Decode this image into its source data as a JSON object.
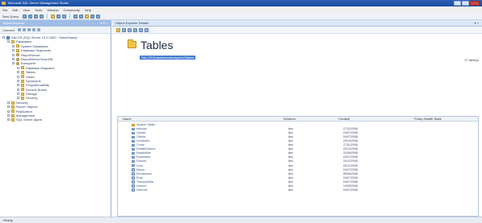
{
  "window": {
    "title": "Microsoft SQL Server Management Studio"
  },
  "menu": [
    "File",
    "Edit",
    "View",
    "Tools",
    "Window",
    "Community",
    "Help"
  ],
  "toolbar": {
    "new_query": "New Query"
  },
  "object_explorer": {
    "title": "Object Explorer",
    "connect_label": "Connect",
    "tree": [
      {
        "label": "SALOS (SQL Server 10.0.1600 - Salos\\Salos)",
        "level": 0,
        "icon": "server"
      },
      {
        "label": "Databases",
        "level": 1,
        "icon": "folder"
      },
      {
        "label": "System Databases",
        "level": 2,
        "icon": "folder"
      },
      {
        "label": "Database Snapshots",
        "level": 2,
        "icon": "folder"
      },
      {
        "label": "ReportServer",
        "level": 2,
        "icon": "database"
      },
      {
        "label": "ReportServerTempDB",
        "level": 2,
        "icon": "database"
      },
      {
        "label": "transporte",
        "level": 2,
        "icon": "database"
      },
      {
        "label": "Database Diagrams",
        "level": 3,
        "icon": "folder"
      },
      {
        "label": "Tables",
        "level": 3,
        "icon": "folder"
      },
      {
        "label": "Views",
        "level": 3,
        "icon": "folder"
      },
      {
        "label": "Synonyms",
        "level": 3,
        "icon": "folder"
      },
      {
        "label": "Programmability",
        "level": 3,
        "icon": "folder"
      },
      {
        "label": "Service Broker",
        "level": 3,
        "icon": "folder"
      },
      {
        "label": "Storage",
        "level": 3,
        "icon": "folder"
      },
      {
        "label": "Security",
        "level": 3,
        "icon": "folder"
      },
      {
        "label": "Security",
        "level": 1,
        "icon": "folder"
      },
      {
        "label": "Server Objects",
        "level": 1,
        "icon": "folder"
      },
      {
        "label": "Replication",
        "level": 1,
        "icon": "folder"
      },
      {
        "label": "Management",
        "level": 1,
        "icon": "folder"
      },
      {
        "label": "SQL Server Agent",
        "level": 1,
        "icon": "folder"
      }
    ]
  },
  "details": {
    "tab_title": "Object Explorer Details",
    "heading": "Tables",
    "path": "SALOS\\Databases\\transporte\\Tables",
    "item_count": "17 Item(s)",
    "columns": {
      "name": "Name",
      "schema": "Schema",
      "created": "Created",
      "policy": "Policy Health State"
    },
    "rows": [
      {
        "name": "System Tables",
        "schema": "",
        "created": "",
        "folder": true
      },
      {
        "name": "Anticipo",
        "schema": "dbo",
        "created": "27/11/2008"
      },
      {
        "name": "Ciudad",
        "schema": "dbo",
        "created": "04/07/2008"
      },
      {
        "name": "Cliente",
        "schema": "dbo",
        "created": "04/07/2008"
      },
      {
        "name": "Conductor",
        "schema": "dbo",
        "created": "29/10/2008"
      },
      {
        "name": "Cuota",
        "schema": "dbo",
        "created": "27/11/2008"
      },
      {
        "name": "DetalleFactura",
        "schema": "dbo",
        "created": "20/12/2008"
      },
      {
        "name": "Estadofiliar",
        "schema": "dbo",
        "created": "31/08/2008"
      },
      {
        "name": "Exportador",
        "schema": "dbo",
        "created": "04/07/2008"
      },
      {
        "name": "Factura",
        "schema": "dbo",
        "created": "20/12/2008"
      },
      {
        "name": "Guia",
        "schema": "dbo",
        "created": "20/11/2008"
      },
      {
        "name": "Marca",
        "schema": "dbo",
        "created": "04/07/2008"
      },
      {
        "name": "Remisiones",
        "schema": "dbo",
        "created": "06/08/2008"
      },
      {
        "name": "Ruta",
        "schema": "dbo",
        "created": "04/07/2008"
      },
      {
        "name": "Transportista",
        "schema": "dbo",
        "created": "04/07/2008"
      },
      {
        "name": "Usuario",
        "schema": "dbo",
        "created": "14/05/2008"
      },
      {
        "name": "Vehiculo",
        "schema": "dbo",
        "created": "04/07/2008"
      }
    ]
  },
  "status": {
    "text": "Ready"
  }
}
